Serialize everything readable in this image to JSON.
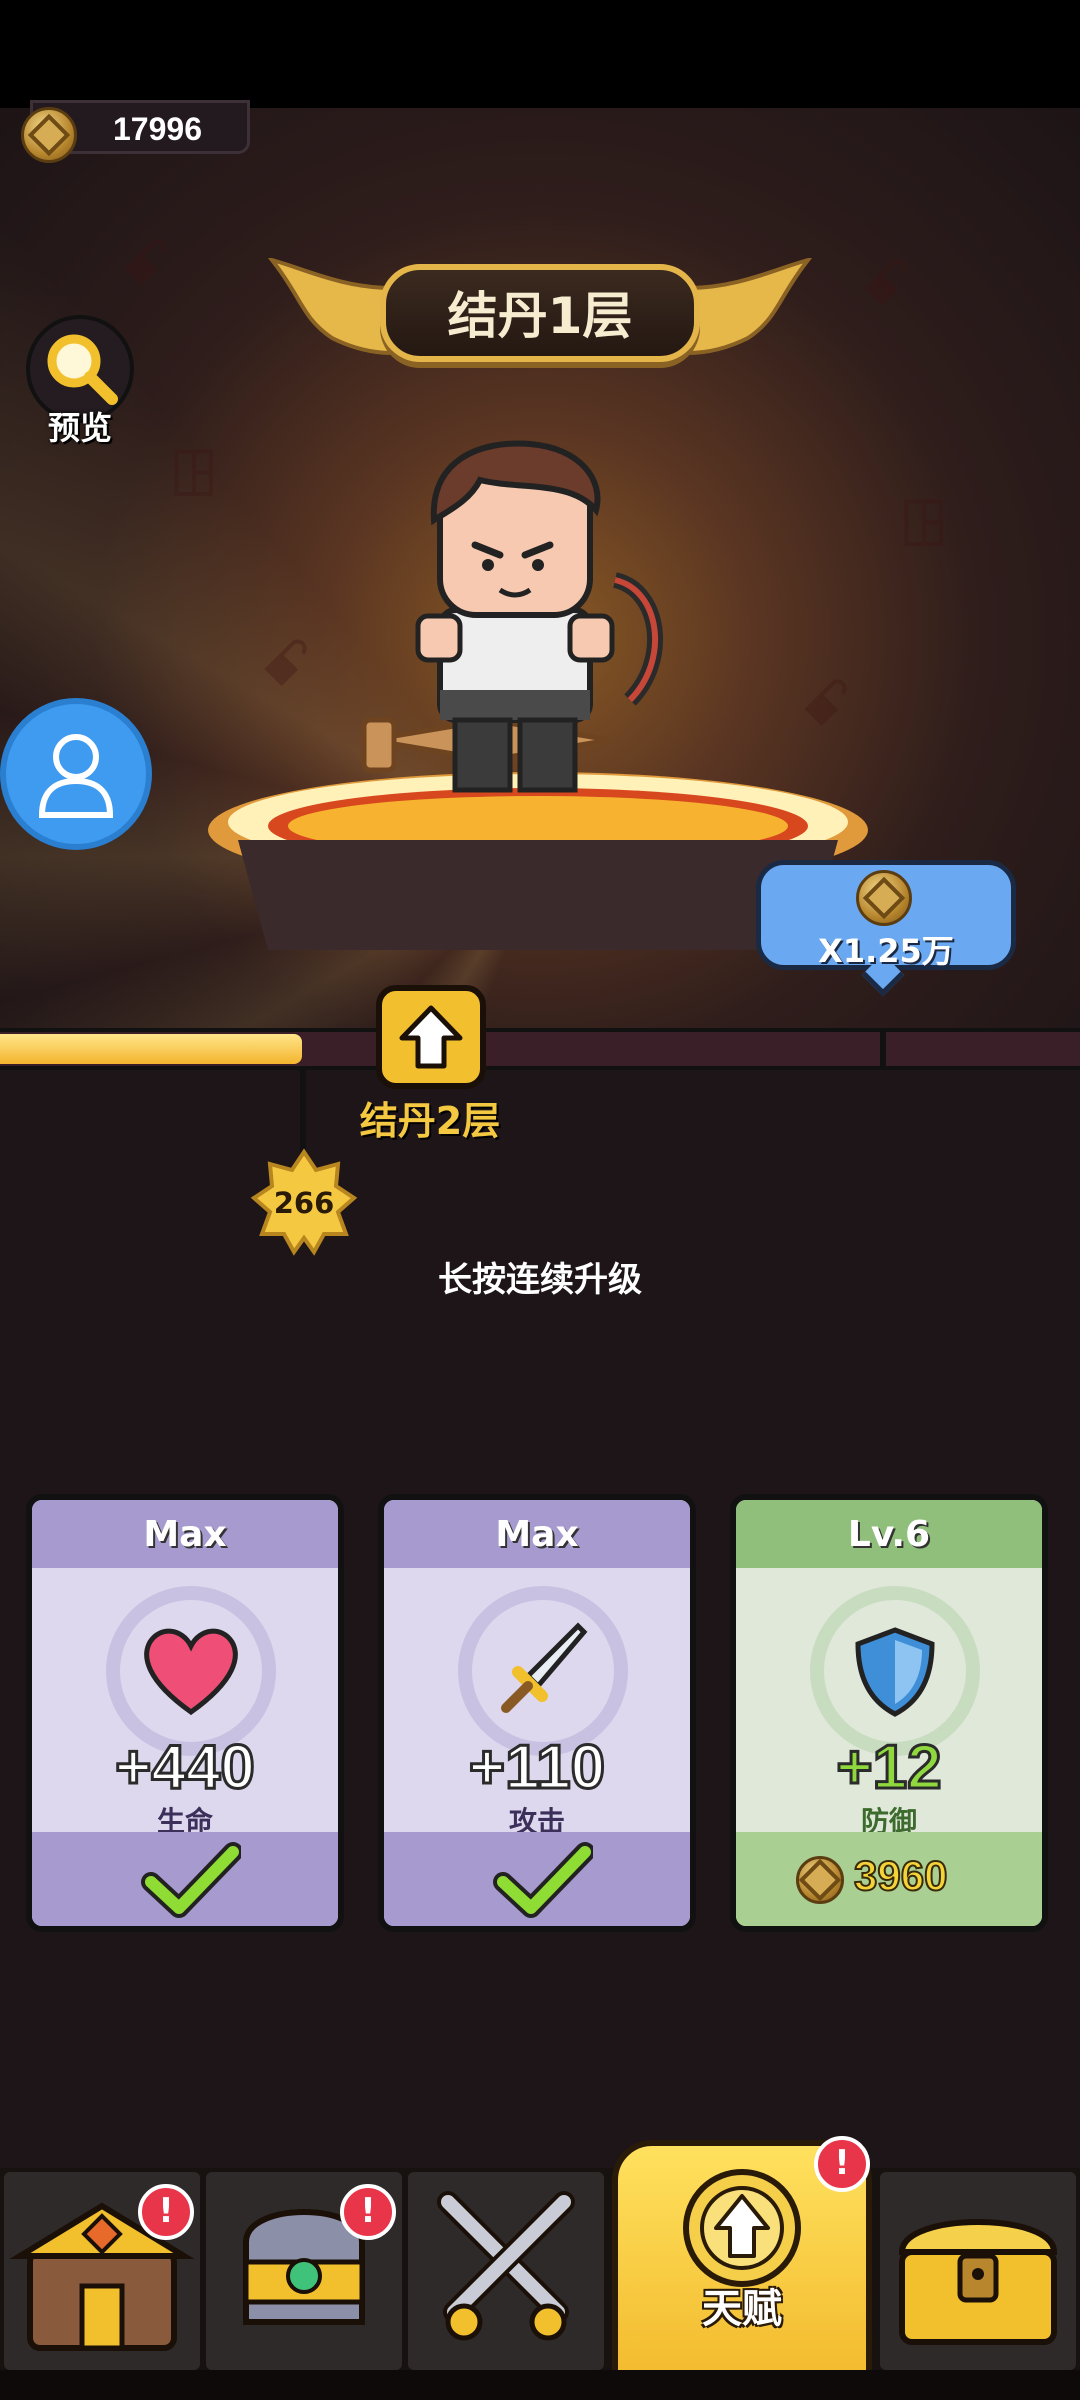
{
  "currency": {
    "coins": "17996",
    "icon": "copper-coin-icon"
  },
  "stage": {
    "title": "结丹1层",
    "next_label": "结丹2层"
  },
  "preview": {
    "label": "预览",
    "icon": "magnifier-icon"
  },
  "multiplier": {
    "text": "X1.25万",
    "icon": "copper-coin-icon"
  },
  "progress": {
    "fraction": 0.28
  },
  "star_badge": {
    "value": "266"
  },
  "hint": "长按连续升级",
  "cards": [
    {
      "header": "Max",
      "value": "+440",
      "name": "生命",
      "icon": "heart-icon",
      "state": "maxed",
      "theme": "purple"
    },
    {
      "header": "Max",
      "value": "+110",
      "name": "攻击",
      "icon": "sword-icon",
      "state": "maxed",
      "theme": "purple"
    },
    {
      "header": "Lv.6",
      "value": "+12",
      "name": "防御",
      "icon": "shield-icon",
      "state": "upgradable",
      "cost": "3960",
      "theme": "green"
    }
  ],
  "nav": {
    "active_label": "天赋",
    "tabs": [
      "shop-house-icon",
      "helmet-icon",
      "crossed-swords-icon",
      "talent-arrow-icon",
      "treasure-chest-icon"
    ],
    "alert_symbol": "!"
  },
  "colors": {
    "gold": "#f5c842",
    "progress": "#f4b52e",
    "avatar_blue": "#3f9bf0",
    "purple_card": "#a79acf",
    "green_card": "#8fbf7b"
  }
}
